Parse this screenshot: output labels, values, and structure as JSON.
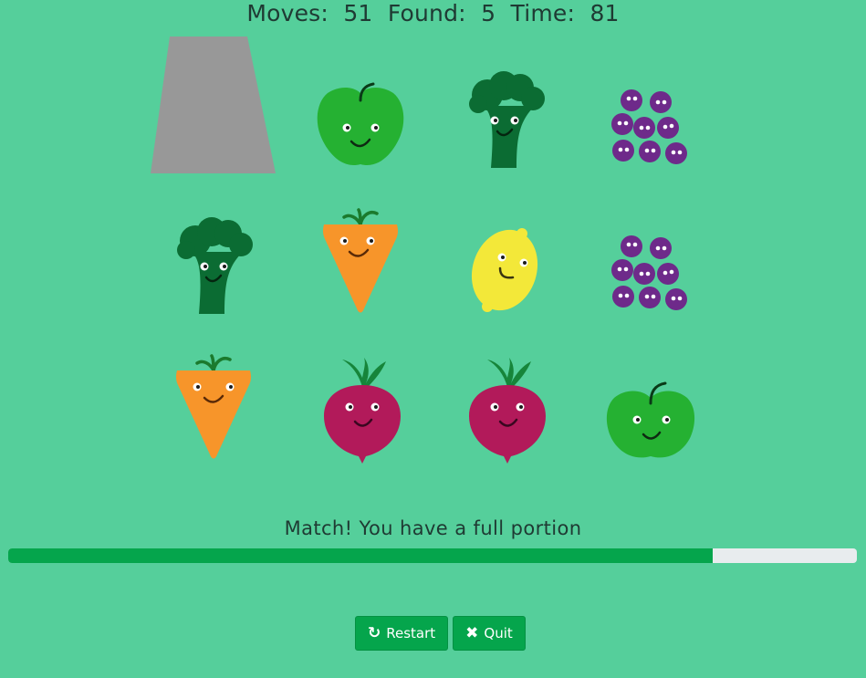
{
  "stats": {
    "moves_label": "Moves:",
    "moves": "51",
    "found_label": "Found:",
    "found": "5",
    "time_label": "Time:",
    "time": "81"
  },
  "cards": [
    {
      "row": 1,
      "col": 1,
      "item": "card-back",
      "state": "hidden"
    },
    {
      "row": 1,
      "col": 2,
      "item": "apple",
      "state": "face-up"
    },
    {
      "row": 1,
      "col": 3,
      "item": "broccoli",
      "state": "face-up"
    },
    {
      "row": 1,
      "col": 4,
      "item": "grapes",
      "state": "face-up"
    },
    {
      "row": 2,
      "col": 1,
      "item": "broccoli",
      "state": "face-up"
    },
    {
      "row": 2,
      "col": 2,
      "item": "carrot",
      "state": "face-up"
    },
    {
      "row": 2,
      "col": 3,
      "item": "lemon",
      "state": "face-up"
    },
    {
      "row": 2,
      "col": 4,
      "item": "grapes",
      "state": "face-up"
    },
    {
      "row": 3,
      "col": 1,
      "item": "carrot",
      "state": "face-up"
    },
    {
      "row": 3,
      "col": 2,
      "item": "beetroot",
      "state": "face-up"
    },
    {
      "row": 3,
      "col": 3,
      "item": "beetroot",
      "state": "face-up"
    },
    {
      "row": 3,
      "col": 4,
      "item": "apple",
      "state": "face-up"
    }
  ],
  "message": "Match! You have a full portion",
  "progress_fraction": 0.83,
  "buttons": {
    "restart_icon": "refresh-icon",
    "restart_label": "Restart",
    "quit_icon": "close-icon",
    "quit_label": "Quit"
  },
  "colors": {
    "background": "#55cf9b",
    "accent": "#05a54c",
    "card_back": "#989898"
  }
}
